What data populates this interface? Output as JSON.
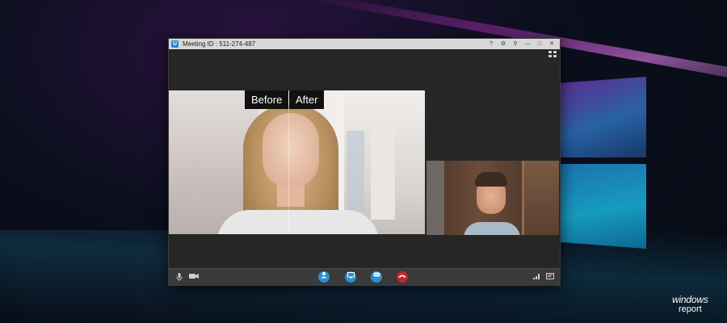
{
  "window": {
    "title": "Meeting ID : 511-274-487",
    "app_icon_letter": "U",
    "controls": {
      "help": "?",
      "settings": "⚙",
      "pin": "⚲",
      "minimize": "—",
      "maximize": "□",
      "close": "✕"
    },
    "layout_icon": "gallery-view-icon"
  },
  "main_video": {
    "before_label": "Before",
    "after_label": "After"
  },
  "toolbar": {
    "left": [
      "microphone-icon",
      "camera-icon"
    ],
    "center": [
      "add-participant-icon",
      "screen-share-icon",
      "chat-icon",
      "end-call-icon"
    ],
    "right": [
      "signal-icon",
      "fullscreen-icon"
    ],
    "colors": {
      "accent": "#1e8ad6",
      "end_call": "#c0292b"
    }
  },
  "brand": {
    "line1": "windows",
    "line2": "report"
  }
}
